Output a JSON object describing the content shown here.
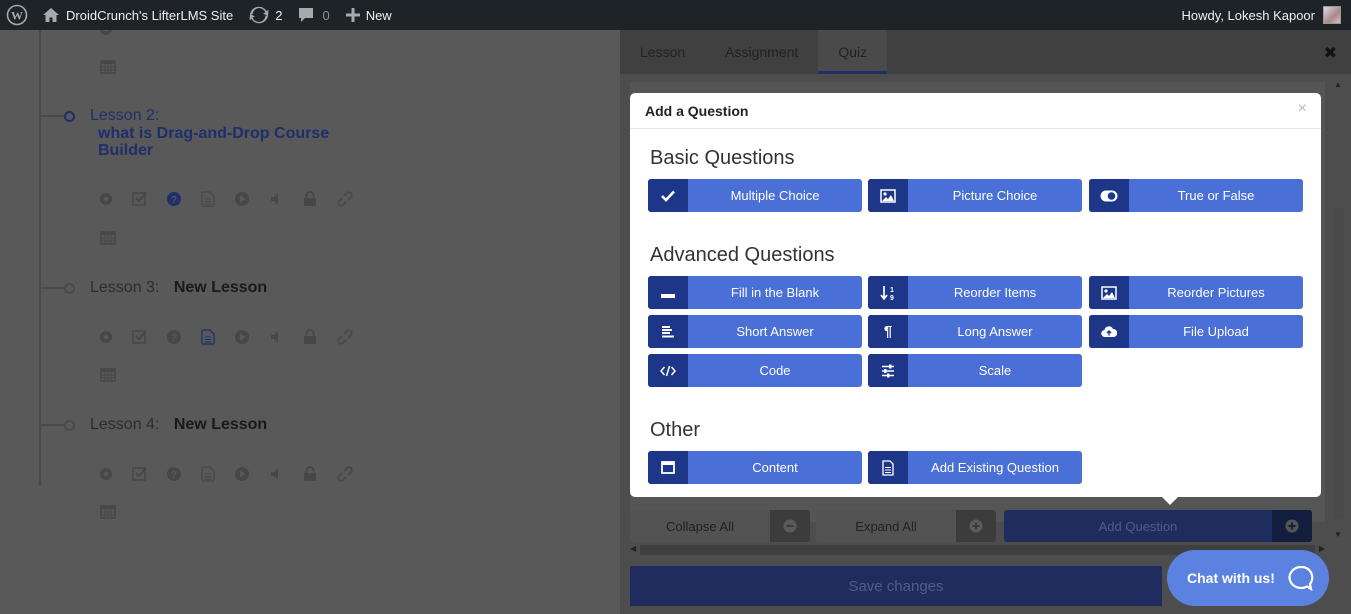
{
  "adminbar": {
    "site_name": "DroidCrunch's LifterLMS Site",
    "updates_count": "2",
    "comments_count": "0",
    "new_label": "New",
    "greeting": "Howdy, Lokesh Kapoor"
  },
  "course": {
    "lessons": [
      {
        "number": "Lesson 2:",
        "title": "what is Drag-and-Drop Course Builder",
        "active": true
      },
      {
        "number": "Lesson 3:",
        "title": "New Lesson",
        "active": false
      },
      {
        "number": "Lesson 4:",
        "title": "New Lesson",
        "active": false
      }
    ]
  },
  "panel": {
    "tabs": [
      "Lesson",
      "Assignment",
      "Quiz"
    ],
    "active_tab": "Quiz",
    "collapse_all": "Collapse All",
    "expand_all": "Expand All",
    "add_question": "Add Question",
    "save_changes": "Save changes"
  },
  "modal": {
    "title": "Add a Question",
    "sections": [
      {
        "title": "Basic Questions",
        "items": [
          {
            "label": "Multiple Choice",
            "icon": "check-icon"
          },
          {
            "label": "Picture Choice",
            "icon": "image-icon"
          },
          {
            "label": "True or False",
            "icon": "toggle-icon"
          }
        ]
      },
      {
        "title": "Advanced Questions",
        "items": [
          {
            "label": "Fill in the Blank",
            "icon": "minus-icon"
          },
          {
            "label": "Reorder Items",
            "icon": "sort-numeric-icon"
          },
          {
            "label": "Reorder Pictures",
            "icon": "image-icon"
          },
          {
            "label": "Short Answer",
            "icon": "align-left-icon"
          },
          {
            "label": "Long Answer",
            "icon": "paragraph-icon"
          },
          {
            "label": "File Upload",
            "icon": "cloud-upload-icon"
          },
          {
            "label": "Code",
            "icon": "code-icon"
          },
          {
            "label": "Scale",
            "icon": "sliders-icon"
          }
        ]
      },
      {
        "title": "Other",
        "items": [
          {
            "label": "Content",
            "icon": "window-icon"
          },
          {
            "label": "Add Existing Question",
            "icon": "file-text-icon"
          }
        ]
      }
    ]
  },
  "chat": {
    "label": "Chat with us!"
  },
  "colors": {
    "accent": "#4a6fd6",
    "accent_dark": "#1d3687",
    "adminbar": "#1d2327",
    "chat": "#5b82e0"
  }
}
